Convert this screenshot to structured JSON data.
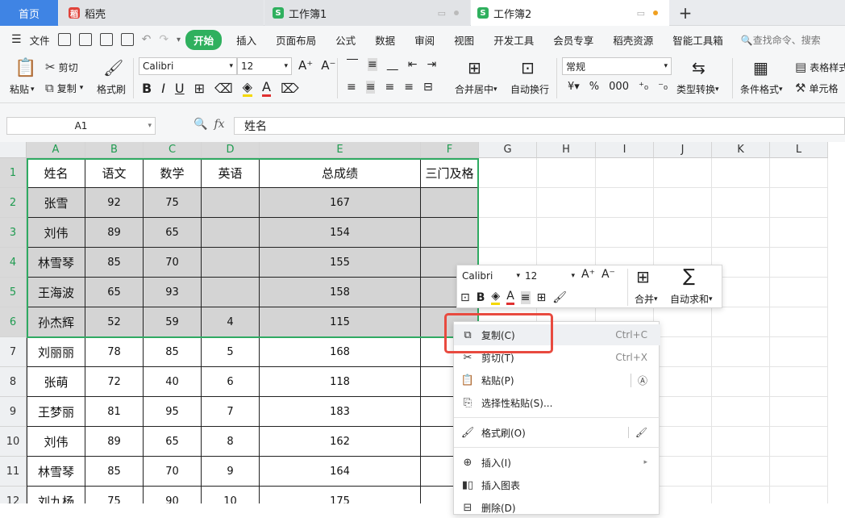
{
  "tabs": {
    "home": "首页",
    "daoke": "稻壳",
    "wb1": "工作簿1",
    "wb2": "工作簿2",
    "add": "+"
  },
  "menu": {
    "file": "文件",
    "items": [
      "开始",
      "插入",
      "页面布局",
      "公式",
      "数据",
      "审阅",
      "视图",
      "开发工具",
      "会员专享",
      "稻壳资源",
      "智能工具箱"
    ],
    "search": "查找命令、搜索"
  },
  "ribbon": {
    "paste": "粘贴",
    "cut": "剪切",
    "copy": "复制",
    "format_painter": "格式刷",
    "font": "Calibri",
    "size": "12",
    "merge": "合并居中",
    "wrap": "自动换行",
    "numfmt": "常规",
    "convert": "类型转换",
    "condfmt": "条件格式",
    "tablestyle": "表格样式",
    "cellfmt": "单元格"
  },
  "formula": {
    "namebox": "A1",
    "fx": "fx",
    "value": "姓名"
  },
  "columns": [
    "A",
    "B",
    "C",
    "D",
    "E",
    "F",
    "G",
    "H",
    "I",
    "J",
    "K",
    "L"
  ],
  "rows": [
    "1",
    "2",
    "3",
    "4",
    "5",
    "6",
    "7",
    "8",
    "9",
    "10",
    "11",
    "12"
  ],
  "table": {
    "headers": [
      "姓名",
      "语文",
      "数学",
      "英语",
      "总成绩",
      "三门及格"
    ],
    "data": [
      [
        "张雪",
        "92",
        "75",
        "",
        "167",
        ""
      ],
      [
        "刘伟",
        "89",
        "65",
        "",
        "154",
        ""
      ],
      [
        "林雪琴",
        "85",
        "70",
        "",
        "155",
        ""
      ],
      [
        "王海波",
        "65",
        "93",
        "",
        "158",
        ""
      ],
      [
        "孙杰辉",
        "52",
        "59",
        "4",
        "115",
        ""
      ],
      [
        "刘丽丽",
        "78",
        "85",
        "5",
        "168",
        ""
      ],
      [
        "张萌",
        "72",
        "40",
        "6",
        "118",
        ""
      ],
      [
        "王梦丽",
        "81",
        "95",
        "7",
        "183",
        ""
      ],
      [
        "刘伟",
        "89",
        "65",
        "8",
        "162",
        ""
      ],
      [
        "林雪琴",
        "85",
        "70",
        "9",
        "164",
        ""
      ],
      [
        "刘九杨",
        "75",
        "90",
        "10",
        "175",
        ""
      ]
    ]
  },
  "mini_toolbar": {
    "font": "Calibri",
    "size": "12",
    "merge": "合并",
    "autosum": "自动求和"
  },
  "context_menu": {
    "copy": "复制(C)",
    "copy_sc": "Ctrl+C",
    "cut": "剪切(T)",
    "cut_sc": "Ctrl+X",
    "paste": "粘贴(P)",
    "paste_special": "选择性粘贴(S)...",
    "format_painter": "格式刷(O)",
    "insert": "插入(I)",
    "insert_chart": "插入图表",
    "delete": "删除(D)"
  },
  "colors": {
    "accent_green": "#2fb05e",
    "home_tab": "#3f84e4",
    "highlight_red": "#e84a3f"
  }
}
